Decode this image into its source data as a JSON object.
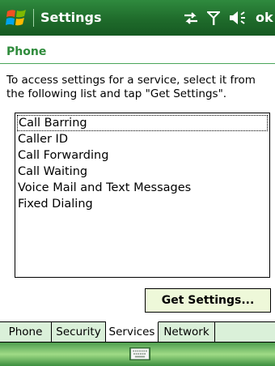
{
  "titlebar": {
    "title": "Settings",
    "ok_label": "ok",
    "icons": [
      "windows-start-icon",
      "connectivity-icon",
      "signal-icon",
      "volume-icon"
    ]
  },
  "header": {
    "title": "Phone"
  },
  "instructions": "To access settings for a service, select it from the following list and tap \"Get Settings\".",
  "services": {
    "items": [
      "Call Barring",
      "Caller ID",
      "Call Forwarding",
      "Call Waiting",
      "Voice Mail and Text Messages",
      "Fixed Dialing"
    ],
    "selected": "Call Barring"
  },
  "get_settings_label": "Get Settings...",
  "tabs": [
    {
      "label": "Phone"
    },
    {
      "label": "Security"
    },
    {
      "label": "Services",
      "active": true
    },
    {
      "label": "Network"
    }
  ],
  "menubar": {
    "icons": [
      "keyboard-icon"
    ]
  },
  "colors": {
    "title_bar": "#1f6b2b",
    "header_text": "#2e8b3b",
    "tab_strip": "#daf0d9",
    "button_bg": "#eef8d9"
  }
}
